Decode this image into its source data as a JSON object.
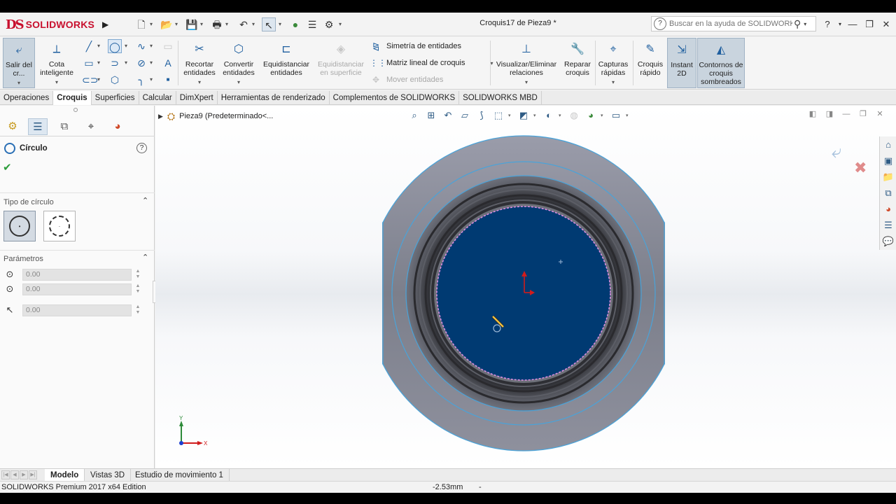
{
  "app": {
    "brand_prefix": "DS",
    "brand_name": "SOLIDWORKS",
    "document_title": "Croquis17 de Pieza9 *",
    "search_placeholder": "Buscar en la ayuda de SOLIDWORKS"
  },
  "command_manager": {
    "exit_sketch": "Salir del cr...",
    "smart_dimension": "Cota inteligente",
    "trim": "Recortar entidades",
    "convert": "Convertir entidades",
    "offset": "Equidistanciar entidades",
    "offset_surface": "Equidistanciar en superficie",
    "mirror": "Simetría de entidades",
    "linear_pattern": "Matriz lineal de croquis",
    "move": "Mover entidades",
    "relations": "Visualizar/Eliminar relaciones",
    "repair": "Reparar croquis",
    "quick_snaps": "Capturas rápidas",
    "rapid_sketch": "Croquis rápido",
    "instant2d": "Instant 2D",
    "shaded_contours": "Contornos de croquis sombreados"
  },
  "tabs": [
    "Operaciones",
    "Croquis",
    "Superficies",
    "Calcular",
    "DimXpert",
    "Herramientas de renderizado",
    "Complementos de SOLIDWORKS",
    "SOLIDWORKS MBD"
  ],
  "active_tab": "Croquis",
  "property_manager": {
    "title": "Círculo",
    "circle_type_header": "Tipo de círculo",
    "params_header": "Parámetros",
    "center_x": "0.00",
    "center_y": "0.00",
    "radius": "0.00"
  },
  "viewport": {
    "tree_breadcrumb": "Pieza9  (Predeterminado<...",
    "axis_x": "X",
    "axis_y": "Y"
  },
  "bottom_tabs": [
    "Modelo",
    "Vistas 3D",
    "Estudio de movimiento 1"
  ],
  "active_bottom_tab": "Modelo",
  "status": {
    "edition": "SOLIDWORKS Premium 2017 x64 Edition",
    "coordinate": "-2.53mm",
    "extra": "-"
  }
}
